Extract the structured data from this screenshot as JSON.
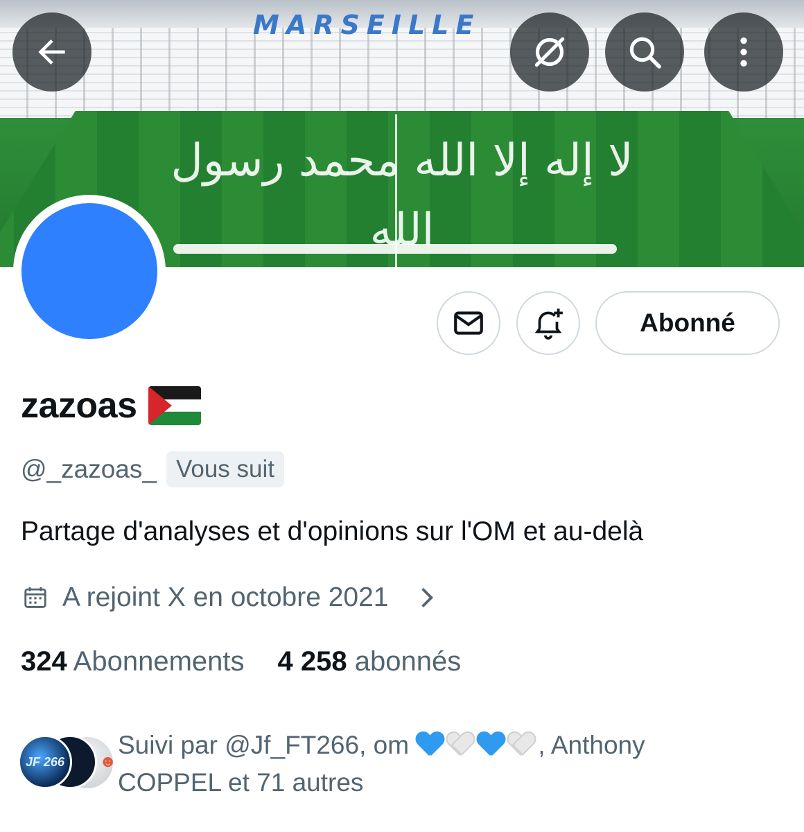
{
  "banner": {
    "stadium_name": "MARSEILLE",
    "pitch_text": "لا إله إلا الله محمد رسول الله"
  },
  "header": {
    "back_icon": "arrow-left-icon",
    "grok_icon": "slashed-circle-icon",
    "search_icon": "search-icon",
    "more_icon": "more-vertical-icon"
  },
  "actions": {
    "message_icon": "envelope-icon",
    "notify_icon": "bell-plus-icon",
    "follow_label": "Abonné"
  },
  "profile": {
    "display_name": "zazoas",
    "handle": "@_zazoas_",
    "follows_you": "Vous suit",
    "bio": "Partage d'analyses et d'opinions sur l'OM et au-delà",
    "joined": "A rejoint X en octobre 2021",
    "avatar_color": "#2f80ff"
  },
  "stats": {
    "following_count": "324",
    "following_label": "Abonnements",
    "followers_count": "4 258",
    "followers_label": "abonnés"
  },
  "followed_by": {
    "avatar1_text": "JF 266",
    "prefix": "Suivi par @Jf_FT266, om",
    "suffix_line1": ", Anthony",
    "suffix_line2": "COPPEL et 71 autres"
  },
  "colors": {
    "text_primary": "#0f1419",
    "text_secondary": "#536471",
    "border": "#cfd9de"
  }
}
